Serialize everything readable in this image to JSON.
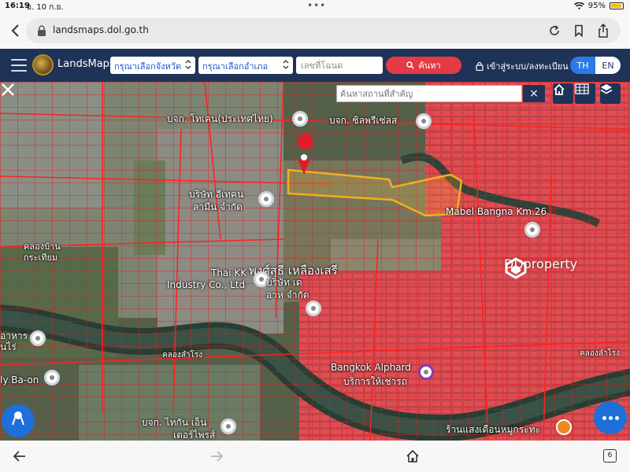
{
  "status_bar": {
    "time": "16:19",
    "date": "อ. 10 ก.ย.",
    "battery_percent": "95%",
    "battery_level": 0.95,
    "wifi_icon": "wifi-icon"
  },
  "browser": {
    "url": "landsmaps.dol.go.th",
    "tab_count": "6"
  },
  "navbar": {
    "brand": "LandsMaps",
    "province_select": "กรุณาเลือกจังหวัด",
    "district_select": "กรุณาเลือกอำเภอ",
    "deed_placeholder": "เลขที่โฉนด",
    "search_label": "ค้นหา",
    "login_label": "เข้าสู่ระบบ/ลงทะเบียน",
    "lang_th": "TH",
    "lang_en": "EN",
    "colors": {
      "navbar_bg": "#1f3358",
      "search_bg": "#e33a44",
      "lang_active": "#2c7be5"
    }
  },
  "map": {
    "place_search_placeholder": "ค้นหาสถานที่สำคัญ",
    "clear_label": "×",
    "watermark": "DDproperty",
    "labels": {
      "toa": "บจก. โทเคน(ประเทศไทย)",
      "silprasert": "บจก. ซิลพรีเซ่ลส",
      "eden": "บริษัท อีเทคน",
      "eden2": "ลามีน จำกัด",
      "mabel": "Mabel Bangna Km.26",
      "phong": "พงศ์สุธี เหลืองเสรี",
      "thai_kk": "Thai KK",
      "thai_kk2": "Industry Co., Ltd",
      "baisin": "บริษัท เด",
      "baisin2": "อาห จำกัด",
      "klong_lamrong": "คลองลำโรง",
      "klong_lamrong2": "คลองลำโรง",
      "klong_ban": "คลองบ้าน",
      "klong_ban2": "กระเทียม",
      "bangkok_alphard": "Bangkok Alphard",
      "bangkok_alphard2": "บริการให้เช่ารถ",
      "baon": "ly Ba-on",
      "tanyon": "บจก. ไทกัน เอ็น",
      "tanyon2": "เตอร์ไพรส์",
      "raan": "ร้านแสงเดือนหมูกระทะ",
      "aharn": "อาหาร",
      "aharn2": "นไร่"
    }
  }
}
